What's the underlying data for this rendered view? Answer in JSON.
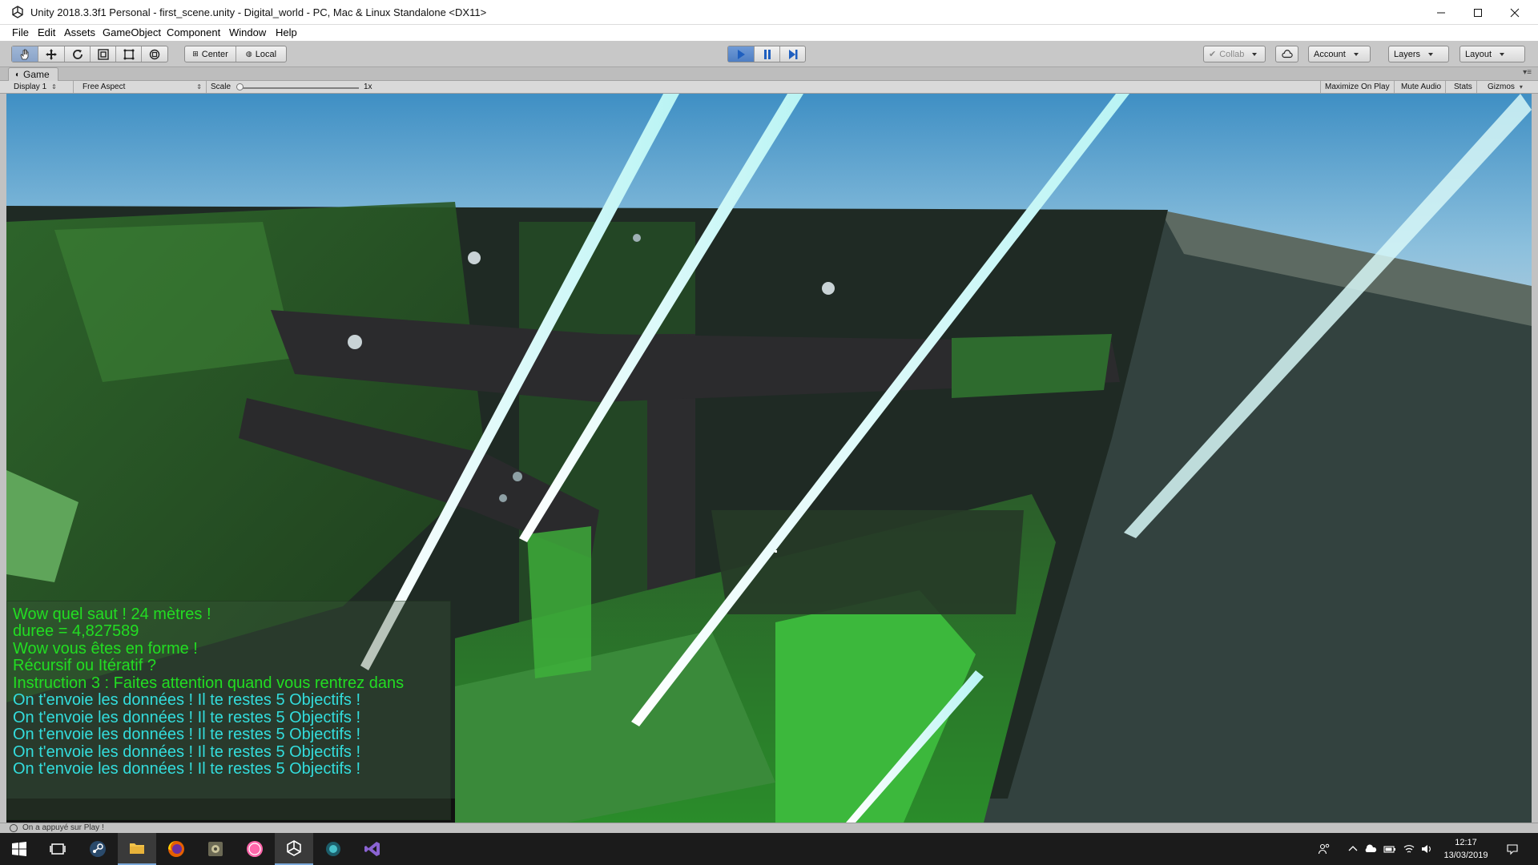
{
  "window": {
    "title": "Unity 2018.3.3f1 Personal - first_scene.unity - Digital_world - PC, Mac & Linux Standalone <DX11>",
    "controls": [
      "minimize-icon",
      "maximize-icon",
      "close-icon"
    ]
  },
  "menu": [
    "File",
    "Edit",
    "Assets",
    "GameObject",
    "Component",
    "Window",
    "Help"
  ],
  "toolbar": {
    "tools": [
      "hand-icon",
      "move-icon",
      "rotate-icon",
      "scale-icon",
      "rect-tool-icon",
      "transform-icon"
    ],
    "pivot": "Center",
    "space": "Local",
    "play_state": "playing",
    "collab": "Collab",
    "account": "Account",
    "layers": "Layers",
    "layout": "Layout"
  },
  "game_tab": {
    "label": "Game",
    "display": "Display 1",
    "aspect": "Free Aspect",
    "scale_label": "Scale",
    "scale_value": "1x",
    "maximize": "Maximize On Play",
    "mute": "Mute Audio",
    "stats": "Stats",
    "gizmos": "Gizmos"
  },
  "console_log": [
    {
      "text": "Wow quel saut ! 24 mètres !",
      "color": "#22dd22"
    },
    {
      "text": "duree = 4,827589",
      "color": "#22dd22"
    },
    {
      "text": "Wow vous êtes en forme !",
      "color": "#22dd22"
    },
    {
      "text": "Récursif ou Itératif ?",
      "color": "#22dd22"
    },
    {
      "text": "Instruction 3 : Faites attention quand vous rentrez dans",
      "color": "#22dd22"
    },
    {
      "text": "On t'envoie les données ! Il te restes 5 Objectifs !",
      "color": "#33dddd"
    },
    {
      "text": "On t'envoie les données ! Il te restes 5 Objectifs !",
      "color": "#33dddd"
    },
    {
      "text": "On t'envoie les données ! Il te restes 5 Objectifs !",
      "color": "#33dddd"
    },
    {
      "text": "On t'envoie les données ! Il te restes 5 Objectifs !",
      "color": "#33dddd"
    },
    {
      "text": "On t'envoie les données ! Il te restes 5 Objectifs !",
      "color": "#33dddd"
    }
  ],
  "status": "On a appuyé sur Play !",
  "taskbar": {
    "apps": [
      "windows-start-icon",
      "task-view-icon",
      "steam-icon",
      "file-explorer-icon",
      "firefox-icon",
      "app-icon",
      "osu-icon",
      "unity-icon",
      "app-teal-icon",
      "visual-studio-icon"
    ],
    "time": "12:17",
    "date": "13/03/2019"
  }
}
